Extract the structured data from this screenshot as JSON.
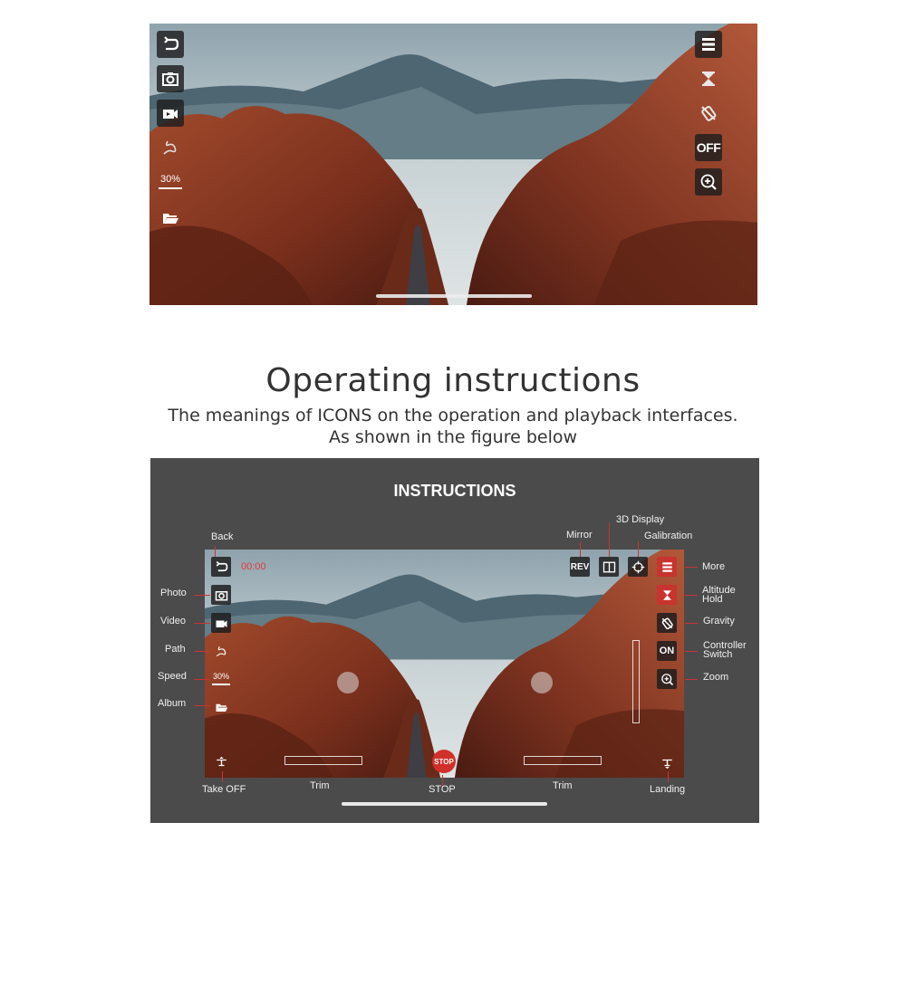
{
  "top_screen": {
    "left_icons": [
      "back-icon",
      "camera-icon",
      "video-icon",
      "path-icon",
      "speed-icon",
      "album-icon"
    ],
    "speed_value": "30%",
    "right_icons": [
      "more-icon",
      "altitude-hold-icon",
      "gravity-icon",
      "controller-switch-icon",
      "zoom-icon"
    ],
    "controller_switch_label": "OFF"
  },
  "heading": {
    "title": "Operating instructions",
    "subtitle_line1": "The meanings of ICONS on the operation and playback interfaces.",
    "subtitle_line2": "As shown in the figure below"
  },
  "instructions": {
    "panel_title": "INSTRUCTIONS",
    "timer": "00:00",
    "speed_value": "30%",
    "mirror_button": "REV",
    "controller_switch_button": "ON",
    "stop_button": "STOP",
    "labels": {
      "back": "Back",
      "photo": "Photo",
      "video": "Video",
      "path": "Path",
      "speed": "Speed",
      "album": "Album",
      "mirror": "Mirror",
      "display_3d": "3D Display",
      "galibration": "Galibration",
      "more": "More",
      "altitude_hold_1": "Altitude",
      "altitude_hold_2": "Hold",
      "gravity": "Gravity",
      "controller_switch_1": "Controller",
      "controller_switch_2": "Switch",
      "zoom": "Zoom",
      "take_off": "Take OFF",
      "trim_left": "Trim",
      "stop": "STOP",
      "trim_right": "Trim",
      "landing": "Landing"
    }
  },
  "colors": {
    "panel_bg": "#4b4b4b",
    "accent_red": "#c8342e",
    "button_bg": "#1e1e1e"
  }
}
